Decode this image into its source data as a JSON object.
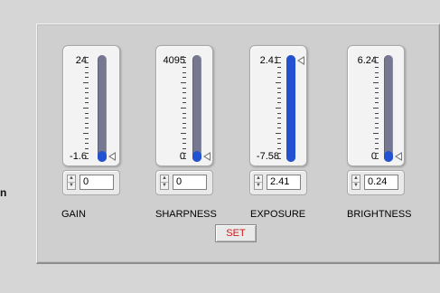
{
  "side_label": "n",
  "controls": [
    {
      "label": "GAIN",
      "max_label": "24",
      "min_label": "-1.6",
      "value": "0",
      "level": 0.06
    },
    {
      "label": "SHARPNESS",
      "max_label": "4095",
      "min_label": "0",
      "value": "0",
      "level": 0.0
    },
    {
      "label": "EXPOSURE",
      "max_label": "2.41",
      "min_label": "-7.58",
      "value": "2.41",
      "level": 1.0
    },
    {
      "label": "BRIGHTNESS",
      "max_label": "6.24",
      "min_label": "0",
      "value": "0.24",
      "level": 0.04
    }
  ],
  "set_button": {
    "label": "SET"
  },
  "colors": {
    "fill": "#2251d1",
    "track": "#767891",
    "set_text": "#d01818"
  }
}
